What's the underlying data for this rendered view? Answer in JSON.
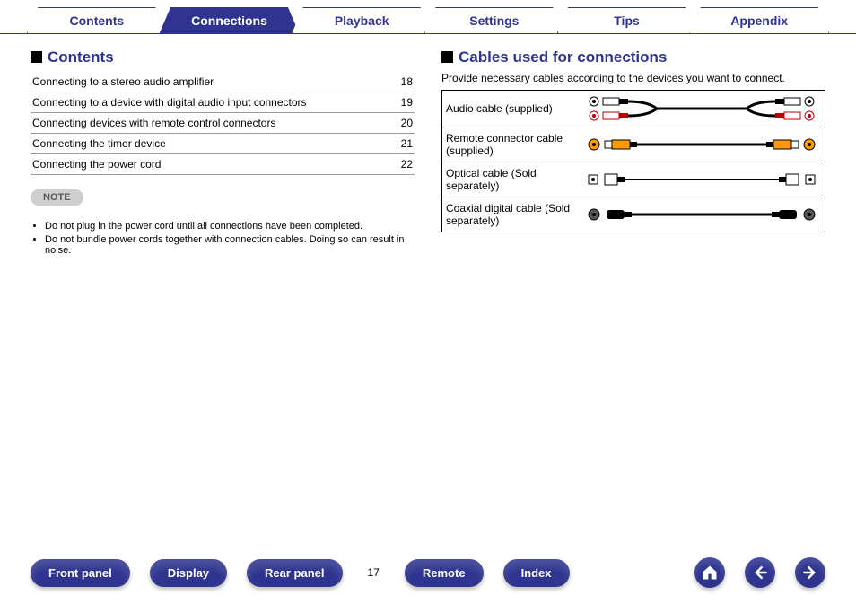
{
  "tabs": [
    {
      "label": "Contents",
      "active": false
    },
    {
      "label": "Connections",
      "active": true
    },
    {
      "label": "Playback",
      "active": false
    },
    {
      "label": "Settings",
      "active": false
    },
    {
      "label": "Tips",
      "active": false
    },
    {
      "label": "Appendix",
      "active": false
    }
  ],
  "left": {
    "heading": "Contents",
    "toc": [
      {
        "title": "Connecting to a stereo audio amplifier",
        "page": "18"
      },
      {
        "title": "Connecting to a device with digital audio input connectors",
        "page": "19"
      },
      {
        "title": "Connecting devices with remote control connectors",
        "page": "20"
      },
      {
        "title": "Connecting the timer device",
        "page": "21"
      },
      {
        "title": "Connecting the power cord",
        "page": "22"
      }
    ],
    "note_label": "NOTE",
    "notes": [
      "Do not plug in the power cord until all connections have been completed.",
      "Do not bundle power cords together with connection cables. Doing so can result in noise."
    ]
  },
  "right": {
    "heading": "Cables used for connections",
    "intro": "Provide necessary cables according to the devices you want to connect.",
    "cables": [
      {
        "label": "Audio cable (supplied)"
      },
      {
        "label": "Remote connector cable (supplied)"
      },
      {
        "label": "Optical cable (Sold separately)"
      },
      {
        "label": "Coaxial digital cable (Sold separately)"
      }
    ]
  },
  "footer": {
    "buttons": [
      "Front panel",
      "Display",
      "Rear panel"
    ],
    "page": "17",
    "buttons2": [
      "Remote",
      "Index"
    ]
  }
}
